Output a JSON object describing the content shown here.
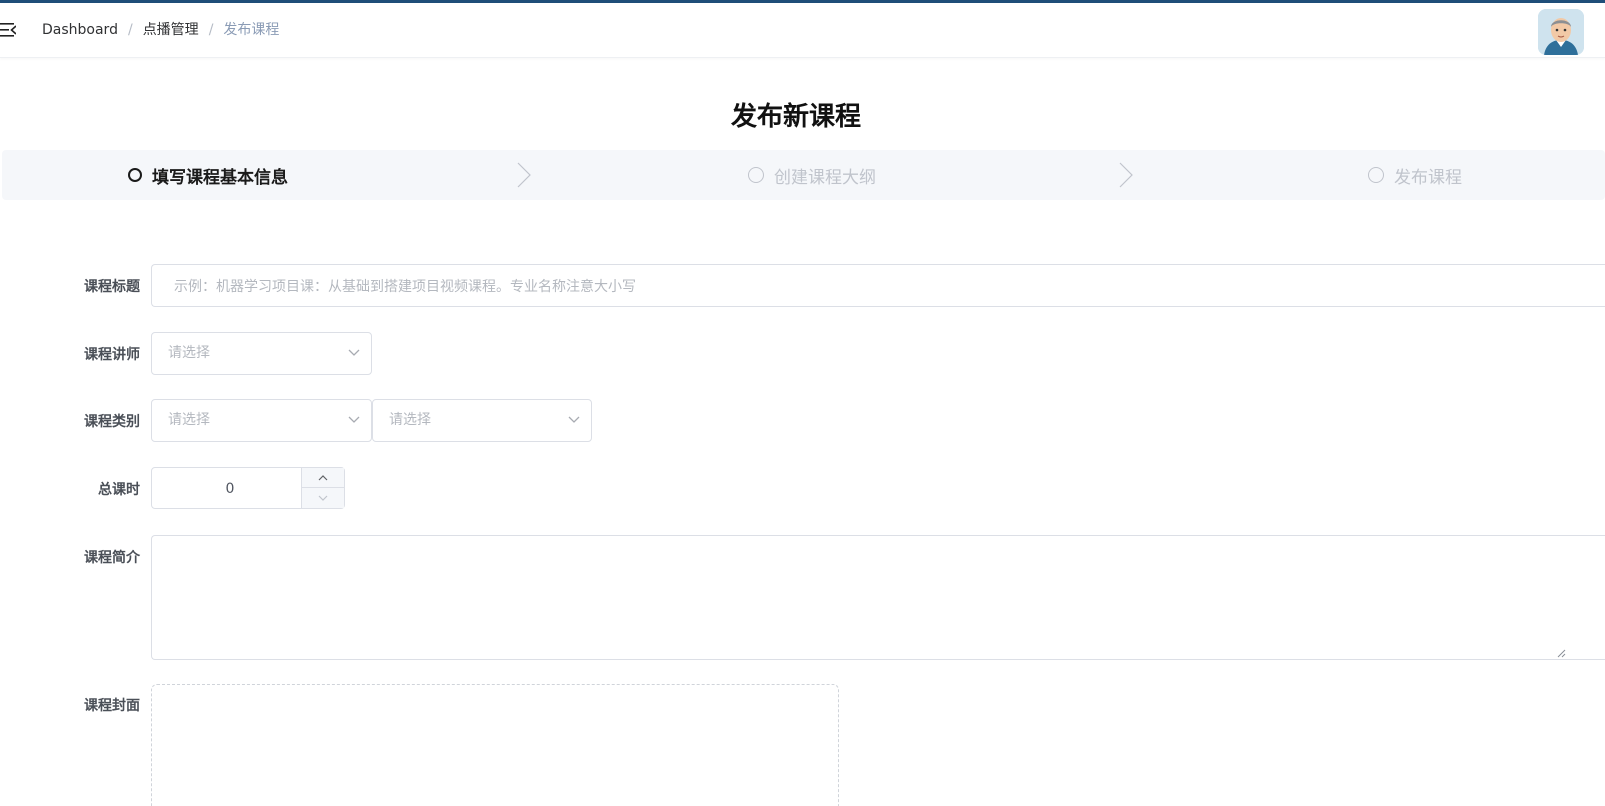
{
  "breadcrumb": {
    "items": [
      "Dashboard",
      "点播管理",
      "发布课程"
    ],
    "separator": "/"
  },
  "page": {
    "title": "发布新课程"
  },
  "steps": [
    {
      "label": "填写课程基本信息",
      "state": "active"
    },
    {
      "label": "创建课程大纲",
      "state": "inactive"
    },
    {
      "label": "发布课程",
      "state": "inactive"
    }
  ],
  "form": {
    "title": {
      "label": "课程标题",
      "placeholder": "示例：机器学习项目课：从基础到搭建项目视频课程。专业名称注意大小写",
      "value": ""
    },
    "teacher": {
      "label": "课程讲师",
      "placeholder": "请选择"
    },
    "category": {
      "label": "课程类别",
      "level1_placeholder": "请选择",
      "level2_placeholder": "请选择"
    },
    "hours": {
      "label": "总课时",
      "value": "0"
    },
    "description": {
      "label": "课程简介",
      "value": ""
    },
    "cover": {
      "label": "课程封面"
    }
  },
  "colors": {
    "top_accent": "#1f4e79",
    "step_bar_bg": "#f5f7fa",
    "placeholder": "#b4b8bf",
    "border": "#dcdfe6"
  },
  "icons": {
    "menu": "hamburger-fold-icon",
    "caret": "chevron-down-icon",
    "step_separator": "chevron-right-icon"
  }
}
